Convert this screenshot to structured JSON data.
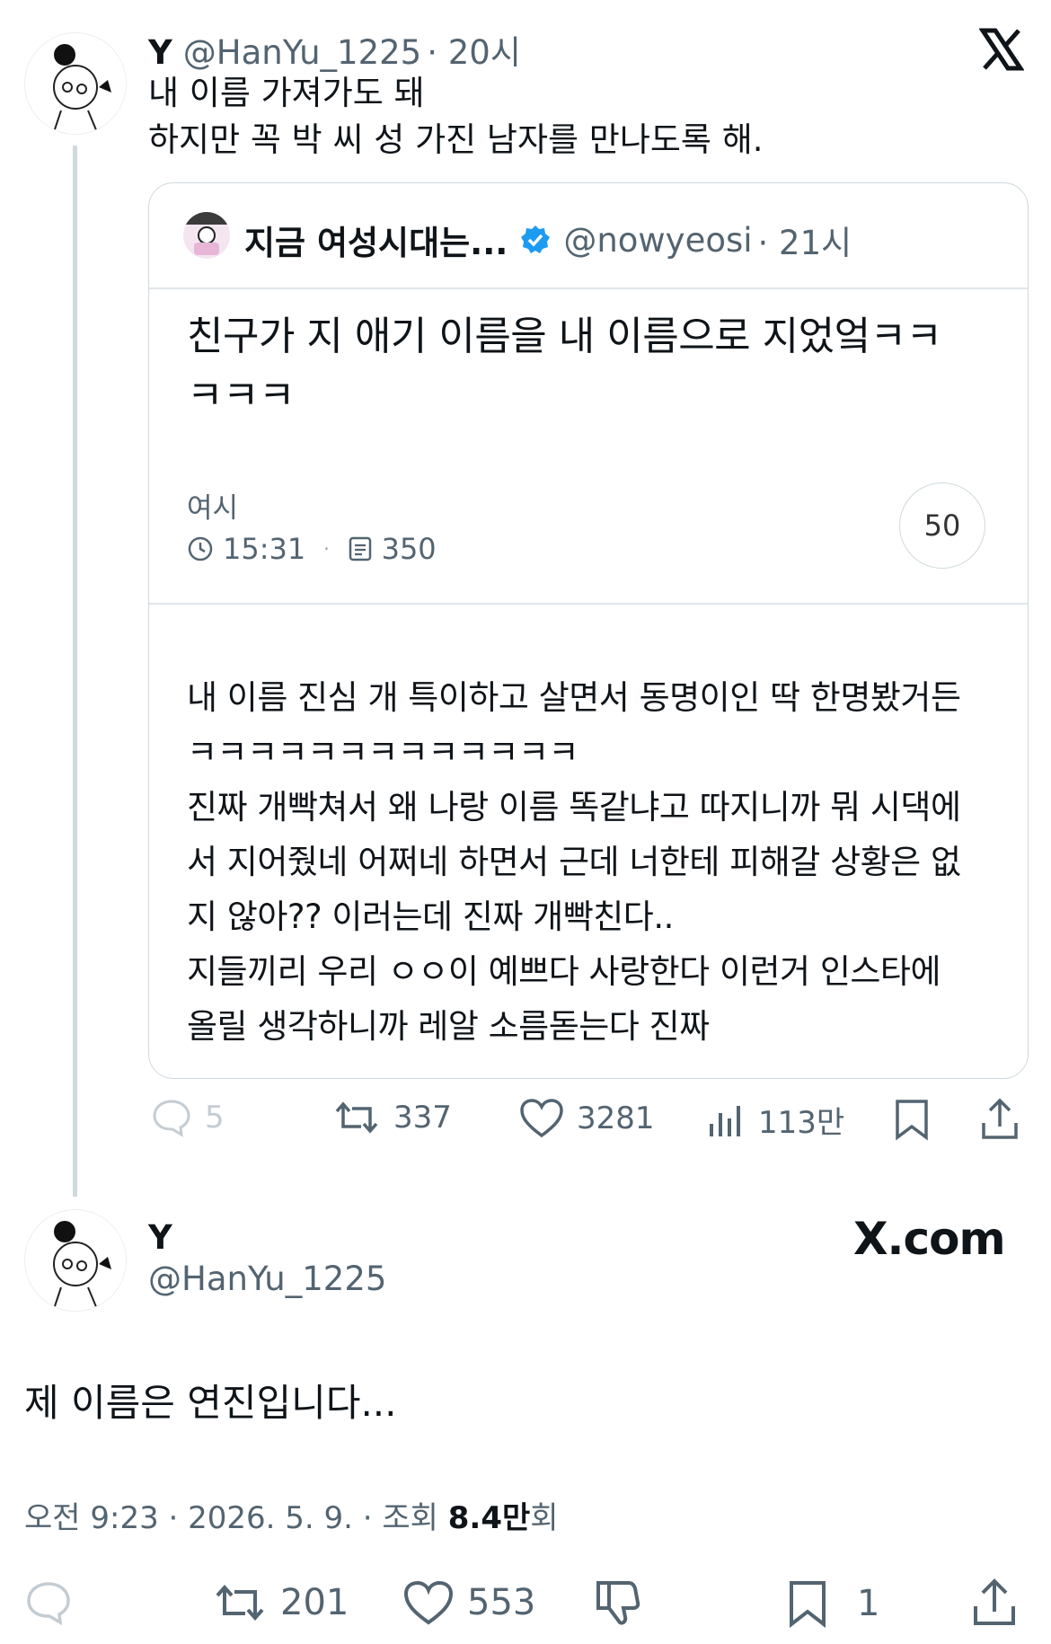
{
  "tweet1": {
    "display_name": "Y",
    "handle": "@HanYu_1225",
    "time": "· 20시",
    "text_lines": [
      "내 이름 가져가도 돼",
      "하지만 꼭 박 씨 성 가진 남자를 만나도록 해."
    ],
    "quote": {
      "display_name": "지금 여성시대는...",
      "handle": "@nowyeosi",
      "time": "· 21시",
      "post_title_lines": [
        "친구가 지 애기 이름을 내 이름으로 지었엌ㅋㅋ",
        "ㅋㅋㅋ"
      ],
      "board": "여시",
      "post_time": "15:31",
      "views": "350",
      "comment_count": "50",
      "body_lines": [
        "내 이름 진심 개 특이하고 살면서 동명이인 딱 한명봤거든",
        "ㅋㅋㅋㅋㅋㅋㅋㅋㅋㅋㅋㅋㅋ",
        "진짜 개빡쳐서 왜 나랑 이름 똑같냐고 따지니까 뭐 시댁에",
        "서 지어줬네 어쩌네 하면서 근데 너한테 피해갈 상황은 없",
        "지 않아?? 이러는데 진짜 개빡친다..",
        "지들끼리 우리 ㅇㅇ이 예쁘다 사랑한다 이런거 인스타에",
        "올릴 생각하니까 레알 소름돋는다 진짜"
      ]
    },
    "stats": {
      "replies": "5",
      "retweets": "337",
      "likes": "3281",
      "views": "113만"
    }
  },
  "tweet2": {
    "display_name": "Y",
    "handle": "@HanYu_1225",
    "watermark": "X.com",
    "text": "제 이름은 연진입니다...",
    "meta_time": "오전 9:23 · 2026. 5. 9. · 조회 ",
    "meta_views": "8.4만",
    "meta_views_suffix": "회",
    "stats": {
      "retweets": "201",
      "likes": "553",
      "bookmarks": "1"
    }
  },
  "x_logo": "𝕏",
  "colors": {
    "verified": "#1d9bf0",
    "text": "#0f1419",
    "secondary": "#536471"
  }
}
